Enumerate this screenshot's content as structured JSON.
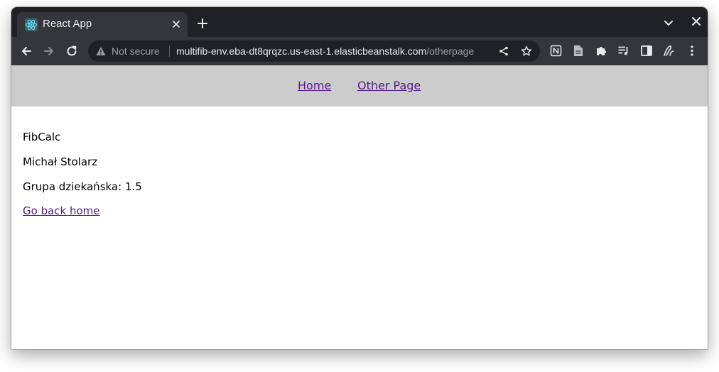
{
  "browser": {
    "tab": {
      "title": "React App"
    },
    "address": {
      "security_label": "Not secure",
      "host": "multifib-env.eba-dt8qrqzc.us-east-1.elasticbeanstalk.com",
      "path": "/otherpage"
    },
    "colors": {
      "frame": "#202124",
      "toolbar": "#35363a",
      "omnibox": "#202124",
      "text": "#e8eaed"
    }
  },
  "app": {
    "nav": {
      "home_label": "Home",
      "other_label": "Other Page"
    },
    "lines": {
      "title": "FibCalc",
      "author": "Michał Stolarz",
      "group": "Grupa dziekańska: 1.5"
    },
    "back_link_label": "Go back home",
    "colors": {
      "header_bg": "#cccccc",
      "link": "#551a8b"
    }
  }
}
